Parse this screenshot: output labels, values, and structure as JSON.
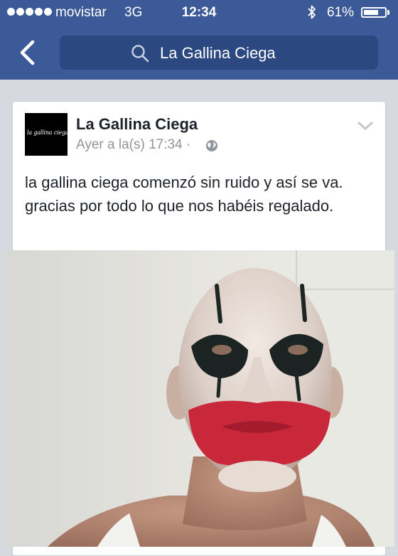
{
  "status_bar": {
    "carrier": "movistar",
    "network": "3G",
    "time": "12:34",
    "battery_percent": "61%",
    "battery_level": 0.61
  },
  "nav": {
    "search_text": "La Gallina Ciega",
    "back_icon": "chevron-left-icon",
    "search_icon": "magnifier-icon"
  },
  "post": {
    "page_name": "La Gallina Ciega",
    "avatar_text": "la gallina ciega",
    "timestamp": "Ayer a la(s) 17:34 ·",
    "privacy_icon": "globe-icon",
    "text": "la gallina ciega comenzó sin ruido y así se va. gracias por todo lo que nos habéis regalado.",
    "image_description_icon": "photo"
  },
  "colors": {
    "brand_blue": "#3d5a98",
    "search_bg": "#2c4880",
    "feed_bg": "#d6d9e0",
    "meta_gray": "#90949c"
  }
}
